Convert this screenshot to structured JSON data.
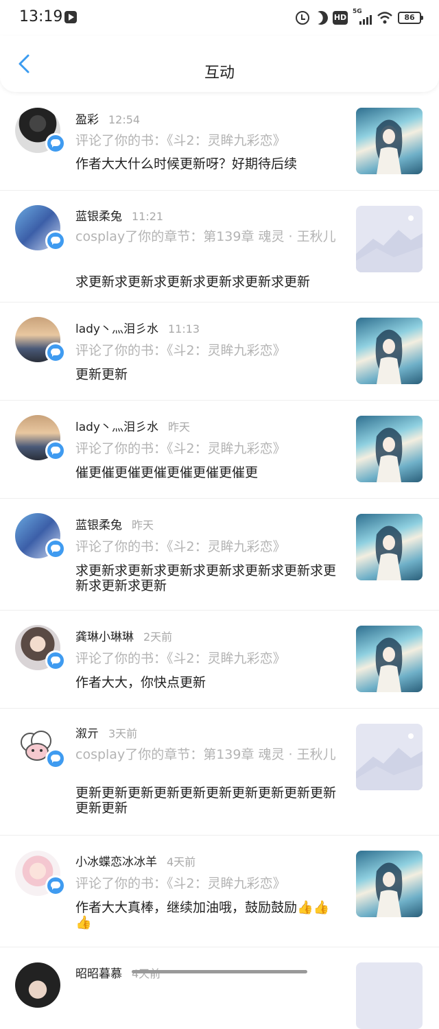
{
  "status_bar": {
    "time": "13:19",
    "network": "5G",
    "battery": "86"
  },
  "nav": {
    "title": "互动"
  },
  "items": [
    {
      "name": "盈彩",
      "time": "12:54",
      "action": "评论了你的书：《斗2：灵眸九彩恋》",
      "comment": "作者大大什么时候更新呀？好期待后续",
      "thumb": "cover"
    },
    {
      "name": "蓝银柔兔",
      "time": "11:21",
      "action": "cosplay了你的章节：第139章 魂灵 · 王秋儿",
      "comment": "求更新求更新求更新求更新求更新求更新",
      "thumb": "placeholder"
    },
    {
      "name": "lady丶灬泪彡水",
      "time": "11:13",
      "action": "评论了你的书：《斗2：灵眸九彩恋》",
      "comment": "更新更新",
      "thumb": "cover"
    },
    {
      "name": "lady丶灬泪彡水",
      "time": "昨天",
      "action": "评论了你的书：《斗2：灵眸九彩恋》",
      "comment": "催更催更催更催更催更催更催更",
      "thumb": "cover"
    },
    {
      "name": "蓝银柔兔",
      "time": "昨天",
      "action": "评论了你的书：《斗2：灵眸九彩恋》",
      "comment": "求更新求更新求更新求更新求更新求更新求更新求更新求更新",
      "thumb": "cover"
    },
    {
      "name": "龚琳小琳琳",
      "time": "2天前",
      "action": "评论了你的书：《斗2：灵眸九彩恋》",
      "comment": "作者大大，你快点更新",
      "thumb": "cover"
    },
    {
      "name": "溆亓",
      "time": "3天前",
      "action": "cosplay了你的章节：第139章 魂灵 · 王秋儿",
      "comment": "更新更新更新更新更新更新更新更新更新更新更新更新",
      "thumb": "placeholder"
    },
    {
      "name": "小冰蝶恋冰冰羊",
      "time": "4天前",
      "action": "评论了你的书：《斗2：灵眸九彩恋》",
      "comment": "作者大大真棒，继续加油哦，鼓励鼓励👍👍👍",
      "thumb": "cover"
    },
    {
      "name": "昭昭暮慕",
      "time": "4天前",
      "action": "",
      "comment": "",
      "thumb": "placeholder"
    }
  ]
}
